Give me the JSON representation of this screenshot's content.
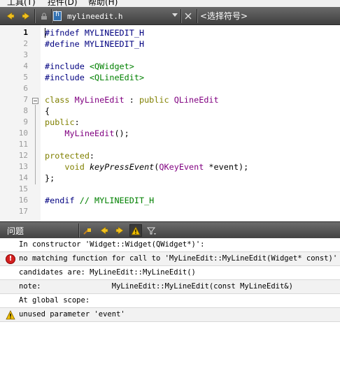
{
  "menubar": {
    "items": [
      "工具(T)",
      "控件(D)",
      "帮助(H)"
    ]
  },
  "toolbar": {
    "back_icon": "arrow-left-icon",
    "forward_icon": "arrow-right-icon",
    "lock_icon": "lock-icon",
    "file_name": "mylineedit.h",
    "close_icon": "close-icon",
    "symbol_placeholder": "<选择符号>"
  },
  "editor": {
    "line_numbers": [
      "1",
      "2",
      "3",
      "4",
      "5",
      "6",
      "7",
      "8",
      "9",
      "10",
      "11",
      "12",
      "13",
      "14",
      "15",
      "16",
      "17"
    ],
    "current_line": 1
  },
  "issues_panel": {
    "title": "问题",
    "items": [
      {
        "type": "info",
        "text": "In constructor 'Widget::Widget(QWidget*)':"
      },
      {
        "type": "error",
        "text": "no matching function for call to 'MyLineEdit::MyLineEdit(Widget* const)'"
      },
      {
        "type": "info",
        "text": "candidates are: MyLineEdit::MyLineEdit()"
      },
      {
        "type": "info",
        "text": "note:                MyLineEdit::MyLineEdit(const MyLineEdit&)"
      },
      {
        "type": "info",
        "text": "At global scope:"
      },
      {
        "type": "warning",
        "text": "unused parameter 'event'"
      }
    ]
  },
  "colors": {
    "keyword": "#808000",
    "preprocessor": "#000080",
    "string": "#008000",
    "type": "#800080",
    "error": "#d42020",
    "warning": "#f0c000"
  }
}
